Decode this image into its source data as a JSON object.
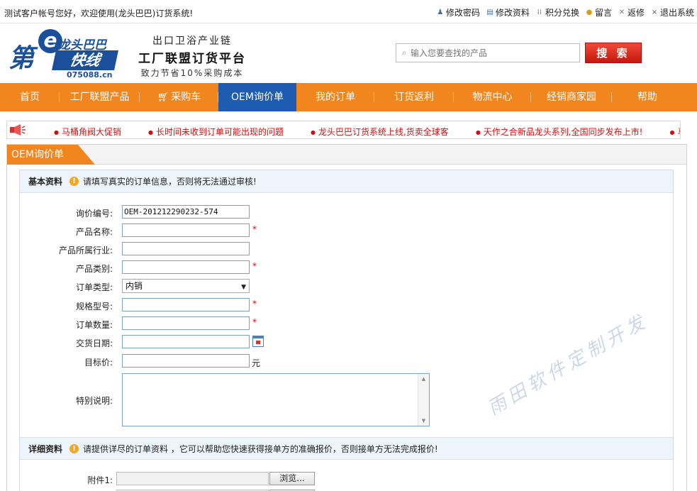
{
  "topbar": {
    "welcome": "测试客户帐号您好，欢迎使用(龙头巴巴)订货系统!",
    "links": [
      {
        "label": "修改密码",
        "icon": "user-icon"
      },
      {
        "label": "修改资料",
        "icon": "profile-card-icon"
      },
      {
        "label": "积分兑换",
        "icon": "grid-dots-icon"
      },
      {
        "label": "留言",
        "icon": "chat-bubble-icon"
      },
      {
        "label": "返修",
        "icon": "tools-icon"
      },
      {
        "label": "退出系统",
        "icon": "close-icon"
      }
    ]
  },
  "logo": {
    "di": "第",
    "e": "e",
    "brand": "龙头巴巴",
    "kuaixian": "快线",
    "url": "075088.cn"
  },
  "slogan": {
    "line1": "出口卫浴产业链",
    "line2": "工厂联盟订货平台",
    "line3": "致力节省10%采购成本"
  },
  "search": {
    "placeholder": "输入您要查找的产品",
    "button": "搜 索"
  },
  "nav": {
    "items": [
      {
        "label": "首页",
        "width": 84
      },
      {
        "label": "工厂联盟产品",
        "width": 113
      },
      {
        "label": "采购车",
        "width": 111,
        "icon": "cart-icon"
      },
      {
        "label": "OEM询价单",
        "width": 110,
        "active": true
      },
      {
        "label": "我的订单",
        "width": 110
      },
      {
        "label": "订货返利",
        "width": 112
      },
      {
        "label": "物流中心",
        "width": 109
      },
      {
        "label": "经销商家园",
        "width": 114
      },
      {
        "label": "帮助",
        "width": 100
      }
    ],
    "accent": "#f1861e",
    "active_color": "#1d5cb0"
  },
  "notice": {
    "items": [
      "马桶角阀大促销",
      "长时间未收到订单可能出现的问题",
      "龙头巴巴订货系统上线,货卖全球客",
      "天作之合新品龙头系列,全国同步发布上市!",
      "马"
    ]
  },
  "panel": {
    "title": "OEM询价单"
  },
  "basic": {
    "title": "基本资料",
    "hint": "请填写真实的订单信息，否则将无法通过审核!",
    "fields": {
      "inquiry_no_label": "询价编号:",
      "inquiry_no_value": "OEM-201212290232-574",
      "product_name_label": "产品名称:",
      "industry_label": "产品所属行业:",
      "category_label": "产品类别:",
      "order_type_label": "订单类型:",
      "order_type_value": "内销",
      "spec_label": "规格型号:",
      "quantity_label": "订单数量:",
      "delivery_date_label": "交货日期:",
      "target_price_label": "目标价:",
      "target_price_unit": "元",
      "notes_label": "特别说明:",
      "required_mark": "*"
    }
  },
  "detail": {
    "title": "详细资料",
    "hint": "请提供详尽的订单资料 ，它可以帮助您快速获得接单方的准确报价，否则接单方无法完成报价!",
    "attachment1_label": "附件1:",
    "browse_label": "浏览..."
  },
  "watermark": "雨田软件定制开发"
}
